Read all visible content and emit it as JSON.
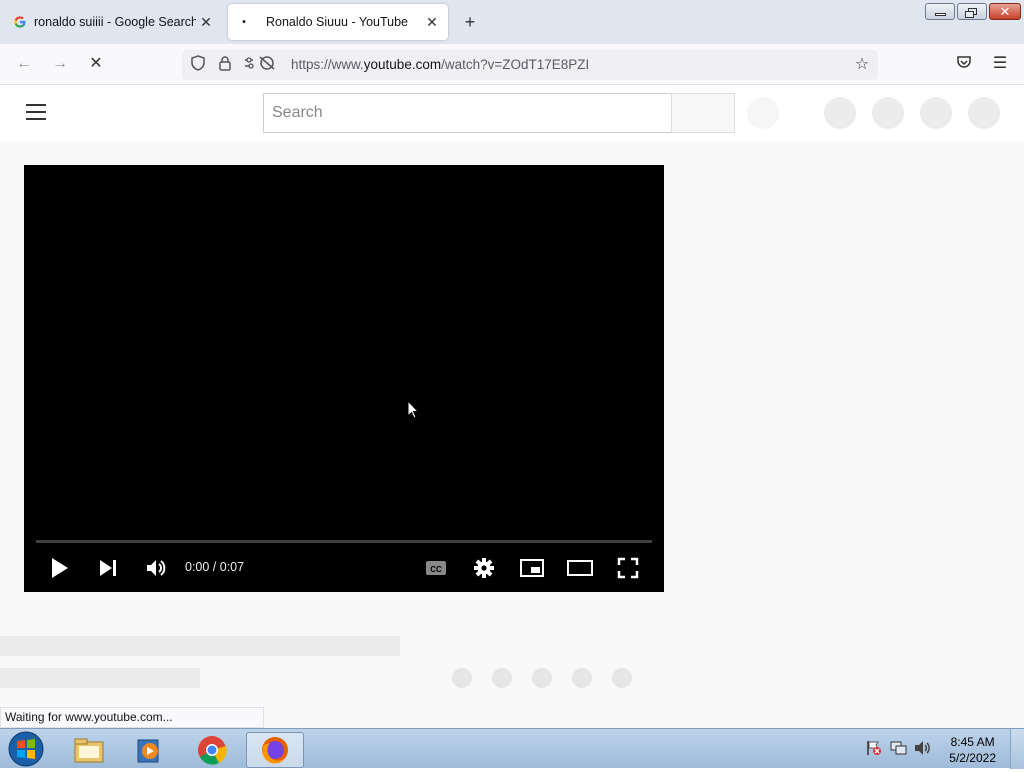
{
  "tabs": [
    {
      "title": "ronaldo suiiii - Google Search",
      "favicon": "google-g-icon",
      "active": false
    },
    {
      "title": "Ronaldo Siuuu - YouTube",
      "favicon": "loading-dot-icon",
      "active": true
    }
  ],
  "urlbar": {
    "prefix": "https://www.",
    "host": "youtube.com",
    "path": "/watch?v=ZOdT17E8PZI"
  },
  "youtube": {
    "search_placeholder": "Search",
    "player": {
      "time": "0:00 / 0:07",
      "progress": 0
    }
  },
  "status_text": "Waiting for www.youtube.com...",
  "taskbar": {
    "time": "8:45 AM",
    "date": "5/2/2022"
  },
  "colors": {
    "tabstrip_bg": "#dfe6ef",
    "player_bg": "#000000",
    "skeleton": "#ececec"
  }
}
